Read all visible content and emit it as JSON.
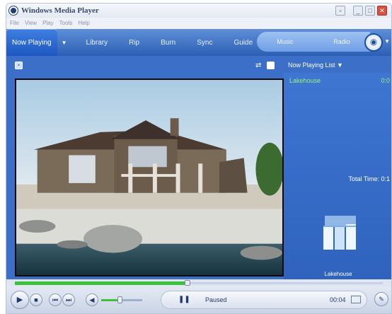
{
  "window": {
    "title": "Windows Media Player"
  },
  "menu": [
    "File",
    "View",
    "Play",
    "Tools",
    "Help"
  ],
  "tabs": [
    "Now Playing",
    "Library",
    "Rip",
    "Burn",
    "Sync",
    "Guide"
  ],
  "media_box": [
    "Music",
    "Radio"
  ],
  "playlist": {
    "label": "Now Playing List",
    "items": [
      {
        "title": "Lakehouse",
        "duration": "0:0"
      }
    ],
    "total_time": "Total Time: 0:1",
    "album_name": "Lakehouse"
  },
  "status": {
    "state": "Paused",
    "time": "00:04"
  },
  "progress": {
    "seek_fraction": 0.47,
    "volume_fraction": 0.45
  },
  "colors": {
    "accent": "#2c5fb4",
    "playlist_text": "#9ef07a",
    "progress": "#3cc23a"
  },
  "icons": [
    "app-logo-icon",
    "play-icon",
    "stop-icon",
    "previous-icon",
    "next-icon",
    "mute-icon",
    "pause-icon",
    "fullscreen-icon"
  ]
}
